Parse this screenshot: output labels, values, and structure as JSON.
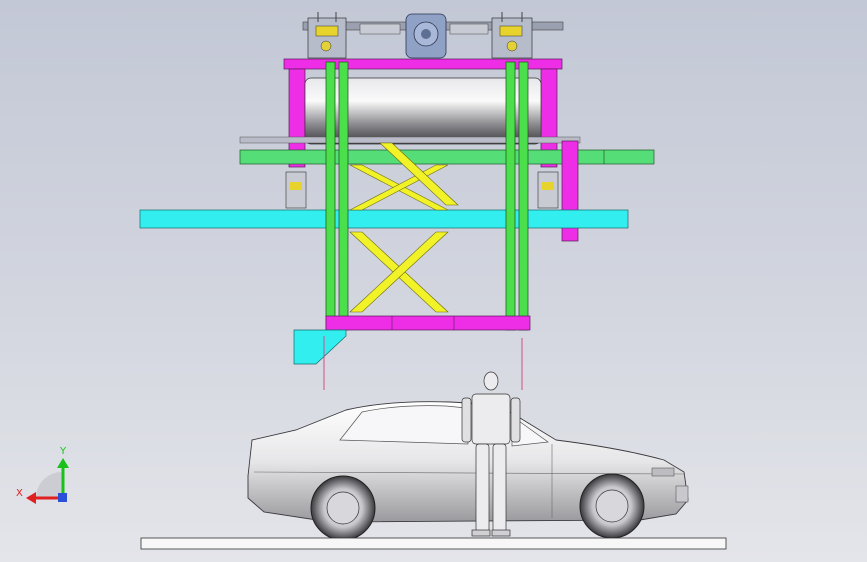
{
  "viewport": {
    "background_top": "#c3c8d6",
    "background_bottom": "#e4e5ea"
  },
  "colors": {
    "magenta_frame": "#ee2ee6",
    "green_column": "#4be04b",
    "cyan_beam": "#33eeee",
    "yellow_scissor": "#f2f229",
    "green_rail": "#55dd77",
    "drum_gray": "#a0a0a4",
    "car_body": "#e8e8ea",
    "ground": "#f7f7f7"
  },
  "triad": {
    "x_label": "X",
    "y_label": "Y",
    "x_color": "#e02020",
    "y_color": "#19c119",
    "z_color": "#2b4fd8"
  },
  "model": {
    "parts": [
      "drive-motor-assembly",
      "roller-drum",
      "scissor-lift",
      "lifting-columns",
      "parking-platform",
      "sedan-car",
      "human-mannequin",
      "floor-base"
    ]
  }
}
